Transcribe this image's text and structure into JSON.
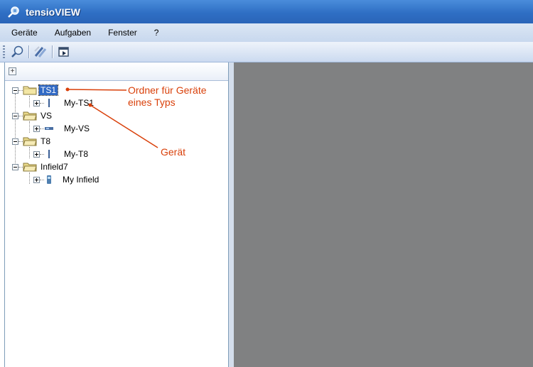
{
  "window": {
    "title": "tensioVIEW"
  },
  "menu": {
    "items": [
      "Geräte",
      "Aufgaben",
      "Fenster",
      "?"
    ]
  },
  "toolbar": {
    "buttons": [
      "search-icon",
      "tools-icon",
      "export-icon"
    ]
  },
  "tree": {
    "folders": [
      {
        "label": "TS1",
        "selected": true,
        "device": "My-TS1"
      },
      {
        "label": "VS",
        "selected": false,
        "device": "My-VS"
      },
      {
        "label": "T8",
        "selected": false,
        "device": "My-T8"
      },
      {
        "label": "Infield7",
        "selected": false,
        "device": "My Infield"
      }
    ]
  },
  "annotations": {
    "folder_note_line1": "Ordner für Geräte",
    "folder_note_line2": "eines Typs",
    "device_note": "Gerät"
  },
  "colors": {
    "accent": "#d9400a",
    "selection": "#316ac5",
    "titlebar": "#2f6fc4",
    "workspace": "#808182"
  }
}
